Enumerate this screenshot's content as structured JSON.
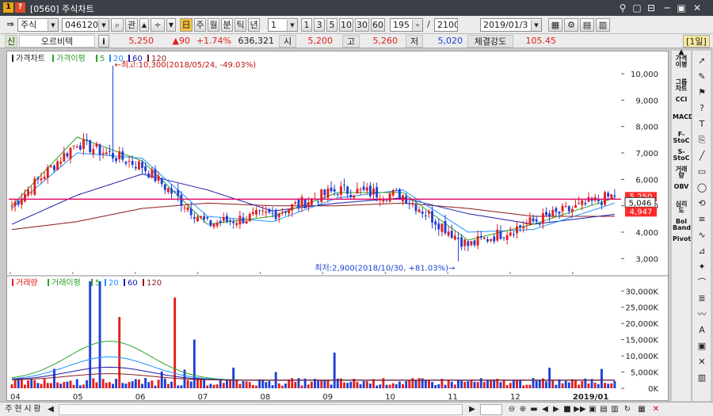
{
  "window": {
    "id_badge": "[0560]",
    "title": "주식차트",
    "app_icon_label": "1",
    "q_icon_label": "?",
    "controls": [
      "⚲",
      "▢",
      "⊟",
      "─",
      "▣",
      "✕"
    ]
  },
  "toolbar": {
    "market_select": "주식",
    "code_input": "046120",
    "gwan_label": "관",
    "periods": [
      "주",
      "월",
      "분",
      "틱",
      "년"
    ],
    "period_value": "1",
    "intervals": [
      "1",
      "3",
      "5",
      "10",
      "30",
      "60"
    ],
    "count_value": "195",
    "total_value": "2100",
    "date_value": "2019/01/3"
  },
  "quote": {
    "sin_label": "신",
    "name": "오르비텍",
    "info_label": "i",
    "price": "5,250",
    "change": "▲90",
    "change_pct": "+1.74%",
    "volume": "636,321",
    "open_label": "시",
    "open": "5,200",
    "high_label": "고",
    "high": "5,260",
    "low_label": "저",
    "low": "5,020",
    "strength_label": "체결강도",
    "strength": "105.45",
    "period_badge": "[1일]"
  },
  "price_panel": {
    "series_label": "가격차트",
    "ma_label": "가격이평",
    "ma_periods": [
      "5",
      "20",
      "60",
      "120"
    ],
    "ma_colors": [
      "#2ca02c",
      "#1e90ff",
      "#1a1aaa",
      "#8b1a1a"
    ],
    "max_annotation": "←최고:10,300(2018/05/24, -49.03%)",
    "min_annotation": "최저:2,900(2018/10/30, +81.03%)→",
    "current_price_tag": "5,250",
    "crosshair_tag": "5,046",
    "prev_tag": "4,947"
  },
  "volume_panel": {
    "series_label": "거래량",
    "ma_label": "거래이평",
    "ma_periods": [
      "5",
      "20",
      "60",
      "120"
    ]
  },
  "chart_data": [
    {
      "type": "candlestick",
      "title": "",
      "x_labels": [
        "04",
        "05",
        "06",
        "07",
        "08",
        "09",
        "10",
        "11",
        "12",
        "2019/01"
      ],
      "y_ticks": [
        "10,000",
        "9,000",
        "8,000",
        "7,000",
        "6,000",
        "5,000",
        "4,000",
        "3,000"
      ],
      "ylim": [
        2500,
        10600
      ],
      "series": [
        {
          "name": "가격이평 5",
          "color": "#2ca02c"
        },
        {
          "name": "20",
          "color": "#1e90ff"
        },
        {
          "name": "60",
          "color": "#1a1aaa"
        },
        {
          "name": "120",
          "color": "#8b1a1a"
        }
      ],
      "months": [
        "04",
        "05",
        "06",
        "07",
        "08",
        "09",
        "10",
        "11",
        "12",
        "2019/01"
      ],
      "close_by_month": [
        5000,
        7400,
        6500,
        4300,
        4700,
        5600,
        5400,
        3500,
        4400,
        5200
      ],
      "max": 10300,
      "min": 2900,
      "last": 5250,
      "ma5_by_month": [
        5000,
        7600,
        6700,
        4300,
        4600,
        5500,
        5500,
        3700,
        4300,
        5100
      ],
      "ma20_by_month": [
        4900,
        7000,
        6800,
        4600,
        4400,
        5300,
        5600,
        4000,
        4100,
        4900
      ],
      "ma60_by_month": [
        4300,
        5400,
        6200,
        5600,
        4800,
        5100,
        5300,
        4700,
        4300,
        4600
      ],
      "ma120_by_month": [
        4100,
        4400,
        4900,
        5100,
        5000,
        5000,
        5100,
        4900,
        4600,
        4600
      ]
    },
    {
      "type": "bar",
      "title": "",
      "y_ticks": [
        "30,000K",
        "25,000K",
        "20,000K",
        "15,000K",
        "10,000K",
        "5,000K",
        "0K"
      ],
      "ylim": [
        0,
        33000
      ],
      "units": "K",
      "series": [
        {
          "name": "거래량"
        }
      ],
      "spikes": [
        {
          "month": "05",
          "value": 33000
        },
        {
          "month": "05",
          "value": 33000
        },
        {
          "month": "06",
          "value": 28000
        },
        {
          "month": "05",
          "value": 22000
        },
        {
          "month": "06",
          "value": 15000
        },
        {
          "month": "08",
          "value": 11000
        }
      ]
    }
  ],
  "right_indicators": [
    "가격이평",
    "그룹차트",
    "CCI",
    "MACD",
    "F-StoC",
    "S-StoC",
    "거래량",
    "OBV",
    "심리도",
    "Bol Band",
    "Pivot"
  ],
  "tools": [
    "arrow-tool",
    "pin-tool",
    "flag-tool",
    "question-tool",
    "text-tool",
    "capture-tool",
    "line-tool",
    "rect-tool",
    "ellipse-tool",
    "cycle-tool",
    "channel-tool",
    "fib-tool",
    "gann-tool",
    "fan-tool",
    "arc-tool",
    "retrace-tool",
    "wave-tool",
    "auto-tool",
    "window-tool",
    "delete-tool",
    "chart-tool"
  ],
  "bottom": {
    "tabs": [
      "주",
      "현",
      "시",
      "황"
    ],
    "nav_buttons": [
      "◀",
      "▶",
      "◀",
      "▶",
      "▶▶",
      "✕"
    ]
  },
  "colors": {
    "up": "#e1201b",
    "down": "#1e3fd6",
    "price_line": "#e10b6a",
    "tag_bg": "#ff2a2a"
  }
}
